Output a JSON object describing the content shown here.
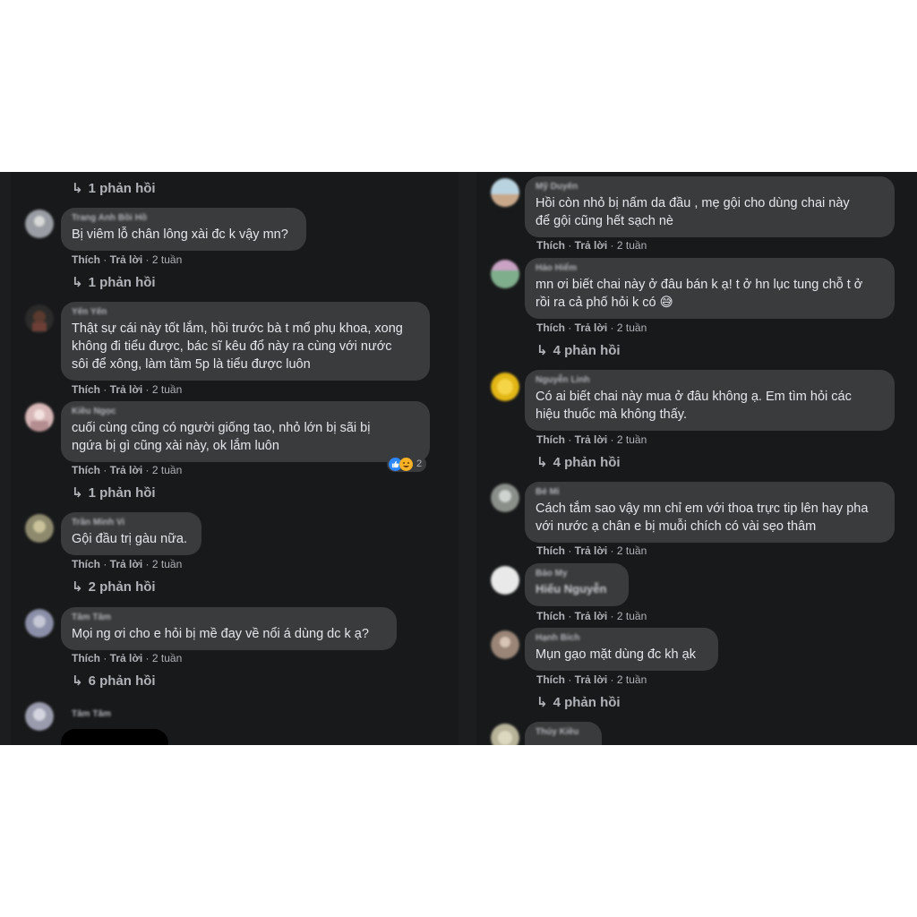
{
  "left_column": {
    "top_reply": "1 phản hồi",
    "comments": [
      {
        "author": "Trang Anh Bồi Hồ",
        "text": "Bị viêm lỗ chân lông xài đc k vậy mn?",
        "like": "Thích",
        "reply": "Trả lời",
        "time": "2 tuần",
        "replies": "1 phản hồi",
        "avatar_color": "#9a9ea4"
      },
      {
        "author": "Yến Yến",
        "text": "Thật sự cái này tốt lắm, hồi trước bà t mổ phụ khoa, xong\nkhông đi tiểu được, bác sĩ kêu đổ này ra cùng với nước\nsôi để xông, làm tầm 5p là tiểu được luôn",
        "like": "Thích",
        "reply": "Trả lời",
        "time": "2 tuần",
        "avatar_color": "#5a3a2e"
      },
      {
        "author": "Kiều Ngọc",
        "text": "cuối cùng cũng có người giống tao, nhỏ lớn bị sãi bị\nngứa bị gì cũng xài này, ok lắm luôn",
        "like": "Thích",
        "reply": "Trả lời",
        "time": "2 tuần",
        "reaction_count": "2",
        "replies": "1 phản hồi",
        "avatar_color": "#d8b7b8"
      },
      {
        "author": "Trần Minh Vi",
        "text": "Gội đầu trị gàu nữa.",
        "like": "Thích",
        "reply": "Trả lời",
        "time": "2 tuần",
        "replies": "2 phản hồi",
        "avatar_color": "#8d8a6e"
      },
      {
        "author": "Tâm Tâm",
        "text": "Mọi ng ơi cho e hỏi bị mề đay về nổi á dùng dc k ạ?",
        "like": "Thích",
        "reply": "Trả lời",
        "time": "2 tuần",
        "replies": "6 phản hồi",
        "avatar_color": "#8b8fa8"
      },
      {
        "author": "Tâm Tâm",
        "avatar_color": "#9a9cae"
      }
    ]
  },
  "right_column": {
    "comments": [
      {
        "author": "Mỹ Duyên",
        "text": "Hồi còn nhỏ bị nấm da đầu , mẹ gội cho dùng chai này\nđể gội cũng hết sạch nè",
        "like": "Thích",
        "reply": "Trả lời",
        "time": "2 tuần",
        "avatar_color": "#c9a88a"
      },
      {
        "author": "Hảo Hiểm",
        "text": "mn ơi biết chai này ở đâu bán k ạ! t ở hn lục tung chỗ t ở\nrồi ra cả phố hỏi k có 😅",
        "like": "Thích",
        "reply": "Trả lời",
        "time": "2 tuần",
        "replies": "4 phản hồi",
        "avatar_color": "#7fae8c"
      },
      {
        "author": "Nguyễn Linh",
        "text": "Có ai biết chai này mua ở đâu không ạ. Em tìm hỏi các\nhiệu thuốc mà không thấy.",
        "like": "Thích",
        "reply": "Trả lời",
        "time": "2 tuần",
        "replies": "4 phản hồi",
        "avatar_color": "#e2b615"
      },
      {
        "author": "Bé Mi",
        "text": "Cách tắm sao vậy mn chỉ em với thoa trực tip lên hay pha\nvới nước ạ chân e bị muỗi chích có vài sẹo thâm",
        "like": "Thích",
        "reply": "Trả lời",
        "time": "2 tuần",
        "avatar_color": "#8a8f8a"
      },
      {
        "author": "Bảo My",
        "mention": "Hiếu Nguyễn",
        "like": "Thích",
        "reply": "Trả lời",
        "time": "2 tuần",
        "avatar_color": "#e9e9e9"
      },
      {
        "author": "Hạnh Bích",
        "text": "Mụn gạo mặt dùng đc kh ạk",
        "like": "Thích",
        "reply": "Trả lời",
        "time": "2 tuần",
        "replies": "4 phản hồi",
        "avatar_color": "#9a8577"
      },
      {
        "author": "Thúy Kiều",
        "avatar_color": "#b8b49a"
      }
    ]
  }
}
